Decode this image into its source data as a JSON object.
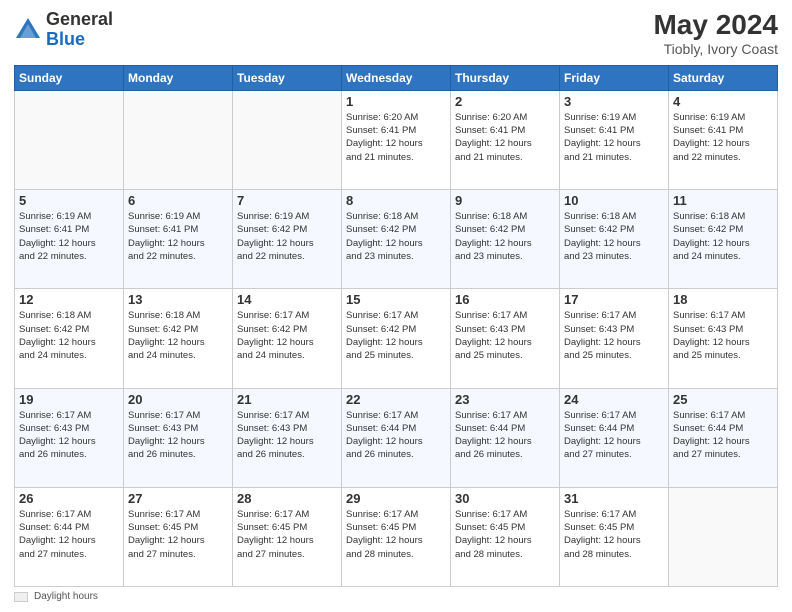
{
  "header": {
    "logo_general": "General",
    "logo_blue": "Blue",
    "month_year": "May 2024",
    "location": "Tiobly, Ivory Coast"
  },
  "days_of_week": [
    "Sunday",
    "Monday",
    "Tuesday",
    "Wednesday",
    "Thursday",
    "Friday",
    "Saturday"
  ],
  "weeks": [
    [
      {
        "day": "",
        "info": ""
      },
      {
        "day": "",
        "info": ""
      },
      {
        "day": "",
        "info": ""
      },
      {
        "day": "1",
        "info": "Sunrise: 6:20 AM\nSunset: 6:41 PM\nDaylight: 12 hours\nand 21 minutes."
      },
      {
        "day": "2",
        "info": "Sunrise: 6:20 AM\nSunset: 6:41 PM\nDaylight: 12 hours\nand 21 minutes."
      },
      {
        "day": "3",
        "info": "Sunrise: 6:19 AM\nSunset: 6:41 PM\nDaylight: 12 hours\nand 21 minutes."
      },
      {
        "day": "4",
        "info": "Sunrise: 6:19 AM\nSunset: 6:41 PM\nDaylight: 12 hours\nand 22 minutes."
      }
    ],
    [
      {
        "day": "5",
        "info": "Sunrise: 6:19 AM\nSunset: 6:41 PM\nDaylight: 12 hours\nand 22 minutes."
      },
      {
        "day": "6",
        "info": "Sunrise: 6:19 AM\nSunset: 6:41 PM\nDaylight: 12 hours\nand 22 minutes."
      },
      {
        "day": "7",
        "info": "Sunrise: 6:19 AM\nSunset: 6:42 PM\nDaylight: 12 hours\nand 22 minutes."
      },
      {
        "day": "8",
        "info": "Sunrise: 6:18 AM\nSunset: 6:42 PM\nDaylight: 12 hours\nand 23 minutes."
      },
      {
        "day": "9",
        "info": "Sunrise: 6:18 AM\nSunset: 6:42 PM\nDaylight: 12 hours\nand 23 minutes."
      },
      {
        "day": "10",
        "info": "Sunrise: 6:18 AM\nSunset: 6:42 PM\nDaylight: 12 hours\nand 23 minutes."
      },
      {
        "day": "11",
        "info": "Sunrise: 6:18 AM\nSunset: 6:42 PM\nDaylight: 12 hours\nand 24 minutes."
      }
    ],
    [
      {
        "day": "12",
        "info": "Sunrise: 6:18 AM\nSunset: 6:42 PM\nDaylight: 12 hours\nand 24 minutes."
      },
      {
        "day": "13",
        "info": "Sunrise: 6:18 AM\nSunset: 6:42 PM\nDaylight: 12 hours\nand 24 minutes."
      },
      {
        "day": "14",
        "info": "Sunrise: 6:17 AM\nSunset: 6:42 PM\nDaylight: 12 hours\nand 24 minutes."
      },
      {
        "day": "15",
        "info": "Sunrise: 6:17 AM\nSunset: 6:42 PM\nDaylight: 12 hours\nand 25 minutes."
      },
      {
        "day": "16",
        "info": "Sunrise: 6:17 AM\nSunset: 6:43 PM\nDaylight: 12 hours\nand 25 minutes."
      },
      {
        "day": "17",
        "info": "Sunrise: 6:17 AM\nSunset: 6:43 PM\nDaylight: 12 hours\nand 25 minutes."
      },
      {
        "day": "18",
        "info": "Sunrise: 6:17 AM\nSunset: 6:43 PM\nDaylight: 12 hours\nand 25 minutes."
      }
    ],
    [
      {
        "day": "19",
        "info": "Sunrise: 6:17 AM\nSunset: 6:43 PM\nDaylight: 12 hours\nand 26 minutes."
      },
      {
        "day": "20",
        "info": "Sunrise: 6:17 AM\nSunset: 6:43 PM\nDaylight: 12 hours\nand 26 minutes."
      },
      {
        "day": "21",
        "info": "Sunrise: 6:17 AM\nSunset: 6:43 PM\nDaylight: 12 hours\nand 26 minutes."
      },
      {
        "day": "22",
        "info": "Sunrise: 6:17 AM\nSunset: 6:44 PM\nDaylight: 12 hours\nand 26 minutes."
      },
      {
        "day": "23",
        "info": "Sunrise: 6:17 AM\nSunset: 6:44 PM\nDaylight: 12 hours\nand 26 minutes."
      },
      {
        "day": "24",
        "info": "Sunrise: 6:17 AM\nSunset: 6:44 PM\nDaylight: 12 hours\nand 27 minutes."
      },
      {
        "day": "25",
        "info": "Sunrise: 6:17 AM\nSunset: 6:44 PM\nDaylight: 12 hours\nand 27 minutes."
      }
    ],
    [
      {
        "day": "26",
        "info": "Sunrise: 6:17 AM\nSunset: 6:44 PM\nDaylight: 12 hours\nand 27 minutes."
      },
      {
        "day": "27",
        "info": "Sunrise: 6:17 AM\nSunset: 6:45 PM\nDaylight: 12 hours\nand 27 minutes."
      },
      {
        "day": "28",
        "info": "Sunrise: 6:17 AM\nSunset: 6:45 PM\nDaylight: 12 hours\nand 27 minutes."
      },
      {
        "day": "29",
        "info": "Sunrise: 6:17 AM\nSunset: 6:45 PM\nDaylight: 12 hours\nand 28 minutes."
      },
      {
        "day": "30",
        "info": "Sunrise: 6:17 AM\nSunset: 6:45 PM\nDaylight: 12 hours\nand 28 minutes."
      },
      {
        "day": "31",
        "info": "Sunrise: 6:17 AM\nSunset: 6:45 PM\nDaylight: 12 hours\nand 28 minutes."
      },
      {
        "day": "",
        "info": ""
      }
    ]
  ],
  "footer": {
    "daylight_label": "Daylight hours"
  }
}
